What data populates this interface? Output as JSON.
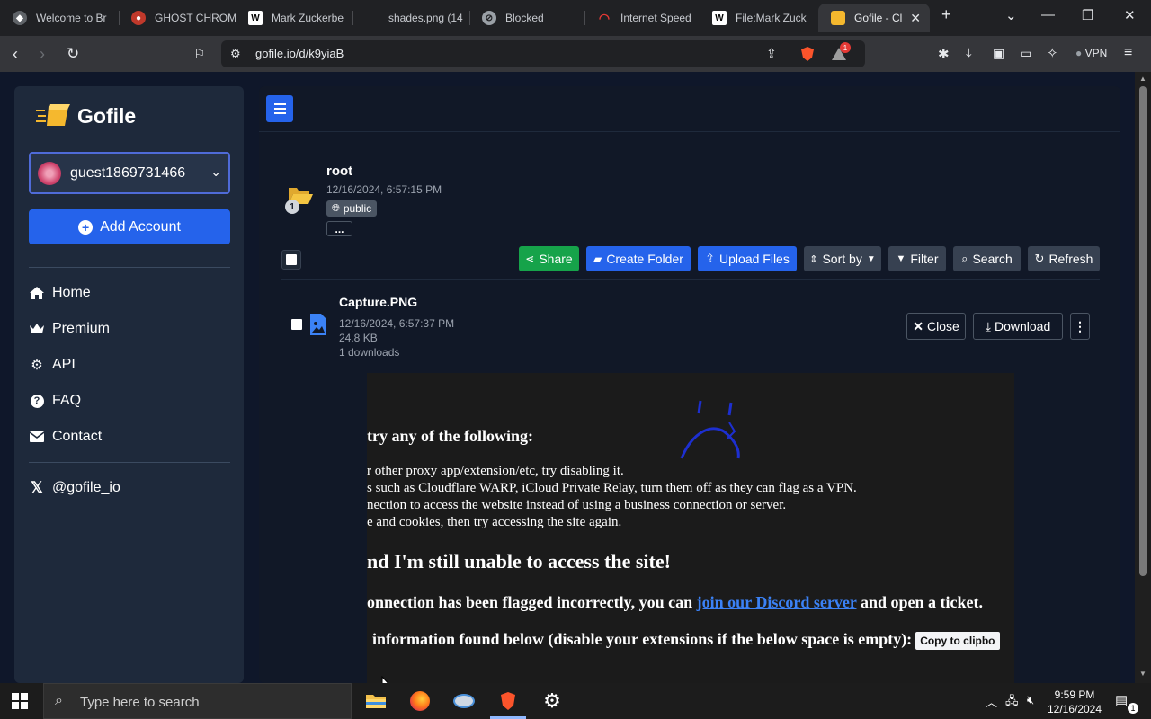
{
  "browser": {
    "tabs": [
      {
        "label": "Welcome to Br",
        "icon": "brave-icon"
      },
      {
        "label": "GHOST CHROM",
        "icon": "ghost-icon"
      },
      {
        "label": "Mark Zuckerbe",
        "icon": "wikipedia-icon"
      },
      {
        "label": "shades.png (14",
        "icon": "image-icon"
      },
      {
        "label": "Blocked",
        "icon": "blocked-icon"
      },
      {
        "label": "Internet Speed",
        "icon": "speedtest-icon"
      },
      {
        "label": "File:Mark Zuck",
        "icon": "wikipedia-icon"
      },
      {
        "label": "Gofile - Cl",
        "icon": "gofile-icon",
        "active": true
      }
    ],
    "url": "gofile.io/d/k9yiaB",
    "shields_badge": "1",
    "vpn_label": "VPN"
  },
  "sidebar": {
    "logo_text": "Gofile",
    "account_name": "guest1869731466",
    "add_account_label": "Add Account",
    "items": [
      {
        "label": "Home",
        "icon": "home-icon"
      },
      {
        "label": "Premium",
        "icon": "crown-icon"
      },
      {
        "label": "API",
        "icon": "gears-icon"
      },
      {
        "label": "FAQ",
        "icon": "question-icon"
      },
      {
        "label": "Contact",
        "icon": "envelope-icon"
      }
    ],
    "social": {
      "label": "@gofile_io",
      "icon": "x-icon"
    }
  },
  "folder": {
    "name": "root",
    "date": "12/16/2024, 6:57:15 PM",
    "badge_count": "1",
    "visibility": "public",
    "more_label": "..."
  },
  "toolbar": {
    "share": "Share",
    "create_folder": "Create Folder",
    "upload_files": "Upload Files",
    "sort_by": "Sort by",
    "filter": "Filter",
    "search": "Search",
    "refresh": "Refresh"
  },
  "file": {
    "name": "Capture.PNG",
    "date": "12/16/2024, 6:57:37 PM",
    "size": "24.8 KB",
    "downloads": "1 downloads",
    "close_label": "Close",
    "download_label": "Download"
  },
  "preview": {
    "heading1": "try any of the following:",
    "lines": [
      "r other proxy app/extension/etc, try disabling it.",
      "s such as Cloudflare WARP, iCloud Private Relay, turn them off as they can flag as a VPN.",
      "nection to access the website instead of using a business connection or server.",
      "e and cookies, then try accessing the site again."
    ],
    "heading2": "nd I'm still unable to access the site!",
    "para_before_link": "onnection has been flagged incorrectly, you can ",
    "link": "join our Discord server",
    "para_after_link": " and open a ticket.",
    "info": "information found below (disable your extensions if the below space is empty):",
    "copy_button": "Copy to clipbo"
  },
  "taskbar": {
    "search_placeholder": "Type here to search",
    "time": "9:59 PM",
    "date": "12/16/2024",
    "notification_count": "1"
  },
  "colors": {
    "accent_blue": "#2563eb",
    "share_green": "#16a34a",
    "sidebar_bg": "#1e293b",
    "page_bg": "#0f172a"
  }
}
